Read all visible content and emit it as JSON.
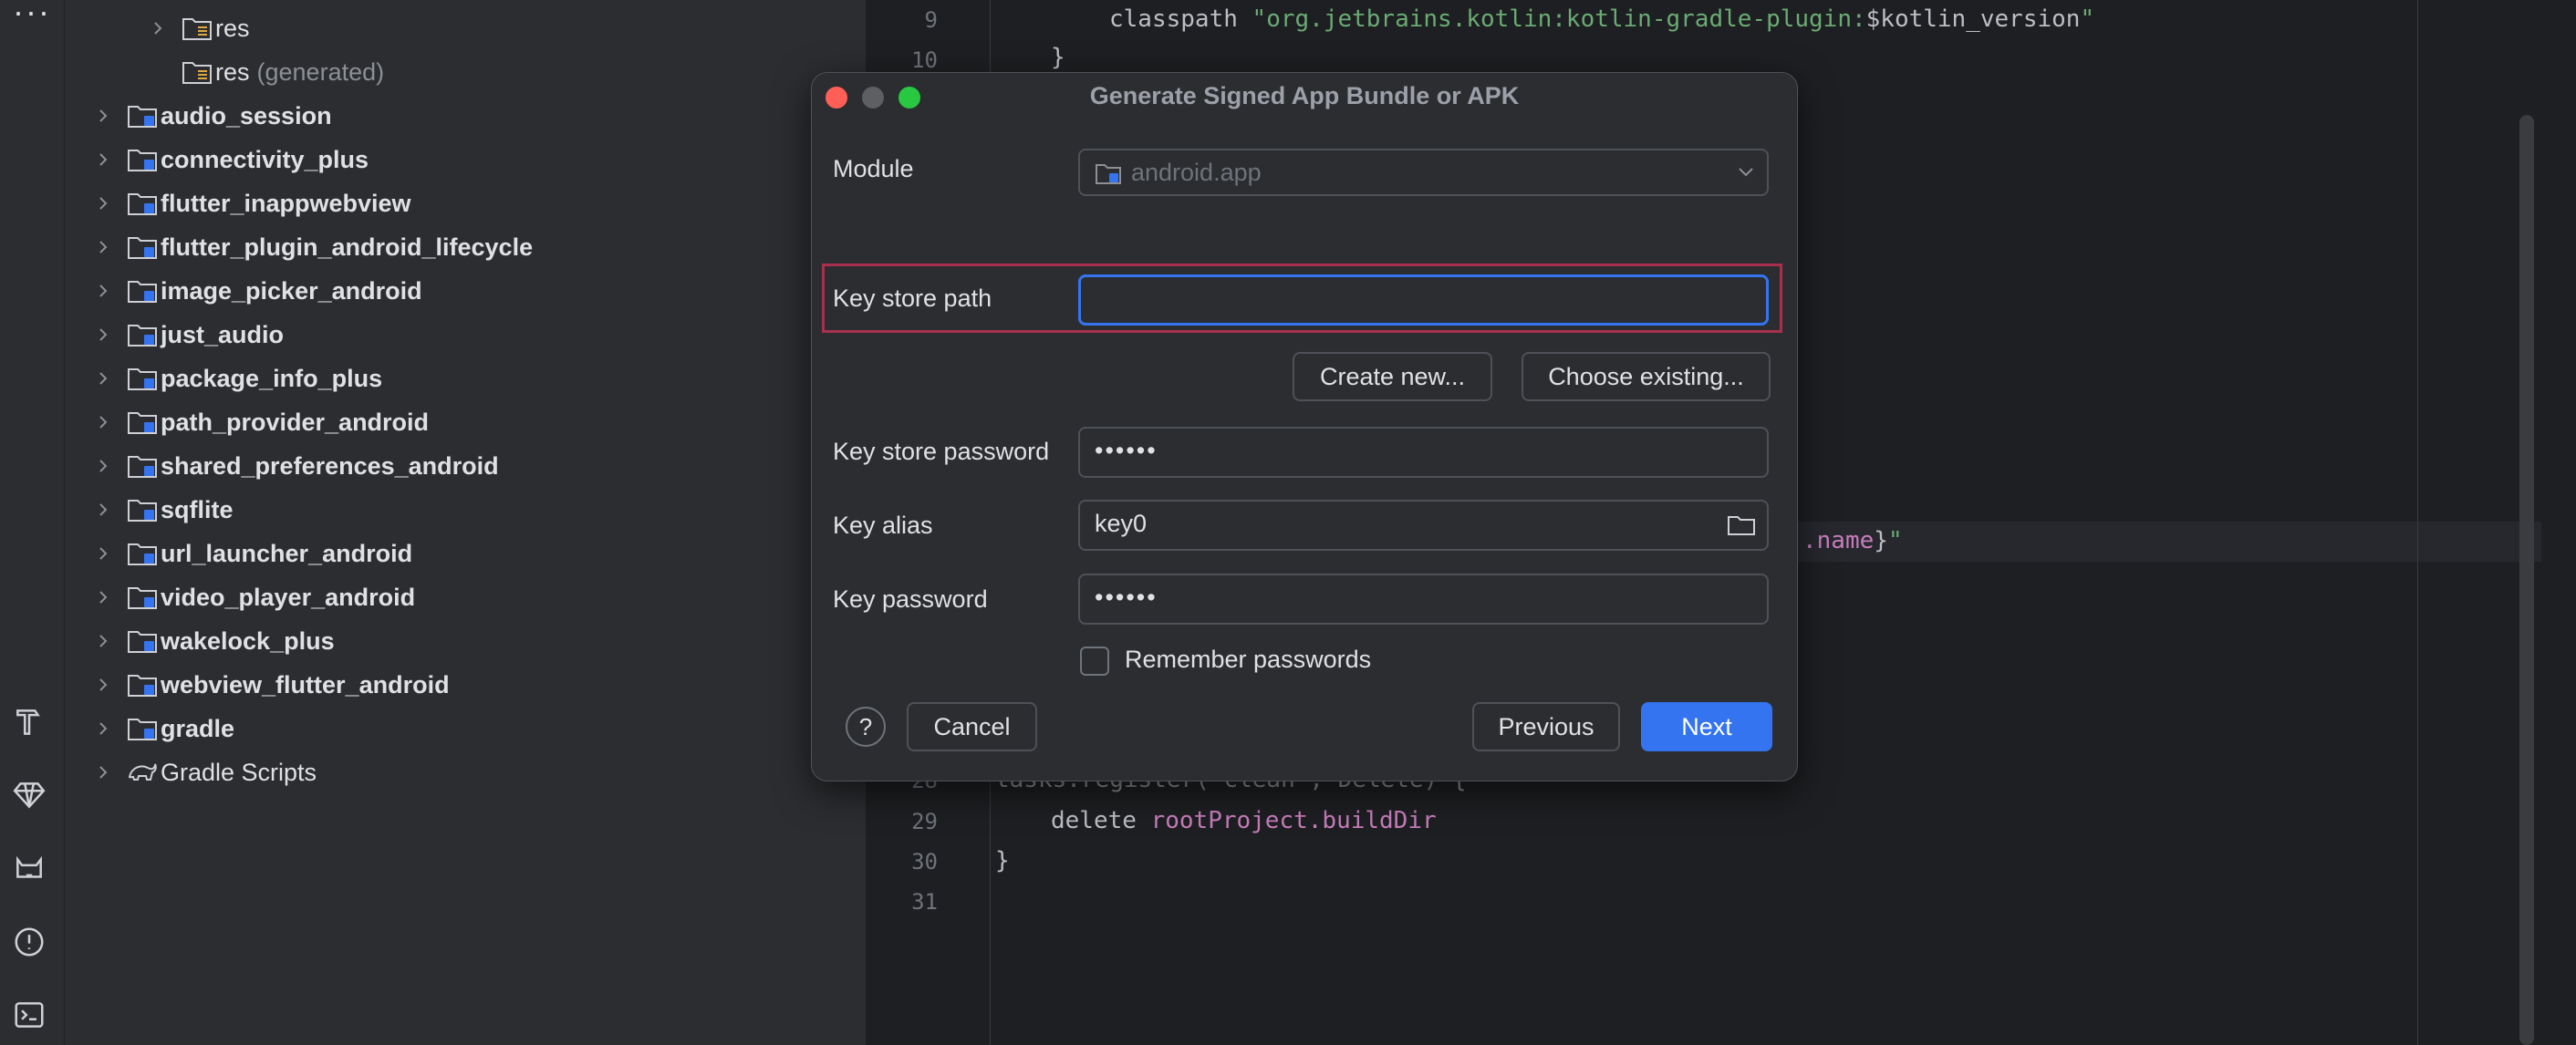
{
  "tree": {
    "items": [
      {
        "label": "res",
        "bold": false,
        "chevron": true,
        "generated": ""
      },
      {
        "label": "res",
        "bold": false,
        "chevron": false,
        "generated": "(generated)"
      },
      {
        "label": "audio_session",
        "bold": true,
        "chevron": true,
        "generated": ""
      },
      {
        "label": "connectivity_plus",
        "bold": true,
        "chevron": true,
        "generated": ""
      },
      {
        "label": "flutter_inappwebview",
        "bold": true,
        "chevron": true,
        "generated": ""
      },
      {
        "label": "flutter_plugin_android_lifecycle",
        "bold": true,
        "chevron": true,
        "generated": ""
      },
      {
        "label": "image_picker_android",
        "bold": true,
        "chevron": true,
        "generated": ""
      },
      {
        "label": "just_audio",
        "bold": true,
        "chevron": true,
        "generated": ""
      },
      {
        "label": "package_info_plus",
        "bold": true,
        "chevron": true,
        "generated": ""
      },
      {
        "label": "path_provider_android",
        "bold": true,
        "chevron": true,
        "generated": ""
      },
      {
        "label": "shared_preferences_android",
        "bold": true,
        "chevron": true,
        "generated": ""
      },
      {
        "label": "sqflite",
        "bold": true,
        "chevron": true,
        "generated": ""
      },
      {
        "label": "url_launcher_android",
        "bold": true,
        "chevron": true,
        "generated": ""
      },
      {
        "label": "video_player_android",
        "bold": true,
        "chevron": true,
        "generated": ""
      },
      {
        "label": "wakelock_plus",
        "bold": true,
        "chevron": true,
        "generated": ""
      },
      {
        "label": "webview_flutter_android",
        "bold": true,
        "chevron": true,
        "generated": ""
      },
      {
        "label": "gradle",
        "bold": true,
        "chevron": true,
        "generated": ""
      },
      {
        "label": "Gradle Scripts",
        "bold": false,
        "chevron": true,
        "generated": ""
      }
    ]
  },
  "editor": {
    "line_numbers": [
      "9",
      "10",
      "28",
      "29",
      "30",
      "31"
    ],
    "line9": {
      "plain": "classpath ",
      "string": "\"org.jetbrains.kotlin:kotlin-gradle-plugin:",
      "var": "$kotlin_version",
      "end": "\""
    },
    "line10": "}",
    "mid": {
      "kw": ".name",
      "brace": "}",
      "end": "\""
    },
    "line28": "tasks.register(\"clean\", Delete) {",
    "line29": {
      "plain": "delete ",
      "kw": "rootProject.buildDir"
    },
    "line30": "}"
  },
  "dialog": {
    "title": "Generate Signed App Bundle or APK",
    "module_label": "Module",
    "module_value": "android.app",
    "keystore_path_label": "Key store path",
    "keystore_path_value": "",
    "create_new": "Create new...",
    "choose_existing": "Choose existing...",
    "keystore_password_label": "Key store password",
    "keystore_password_value": "••••••",
    "key_alias_label": "Key alias",
    "key_alias_value": "key0",
    "key_password_label": "Key password",
    "key_password_value": "••••••",
    "remember_label": "Remember passwords",
    "remember_checked": false,
    "help": "?",
    "cancel": "Cancel",
    "previous": "Previous",
    "next": "Next"
  },
  "colors": {
    "accent": "#3574f0",
    "highlight_border": "#a8304d",
    "close": "#ff5f57",
    "minimize": "#5d5f63",
    "zoom": "#28c840"
  }
}
